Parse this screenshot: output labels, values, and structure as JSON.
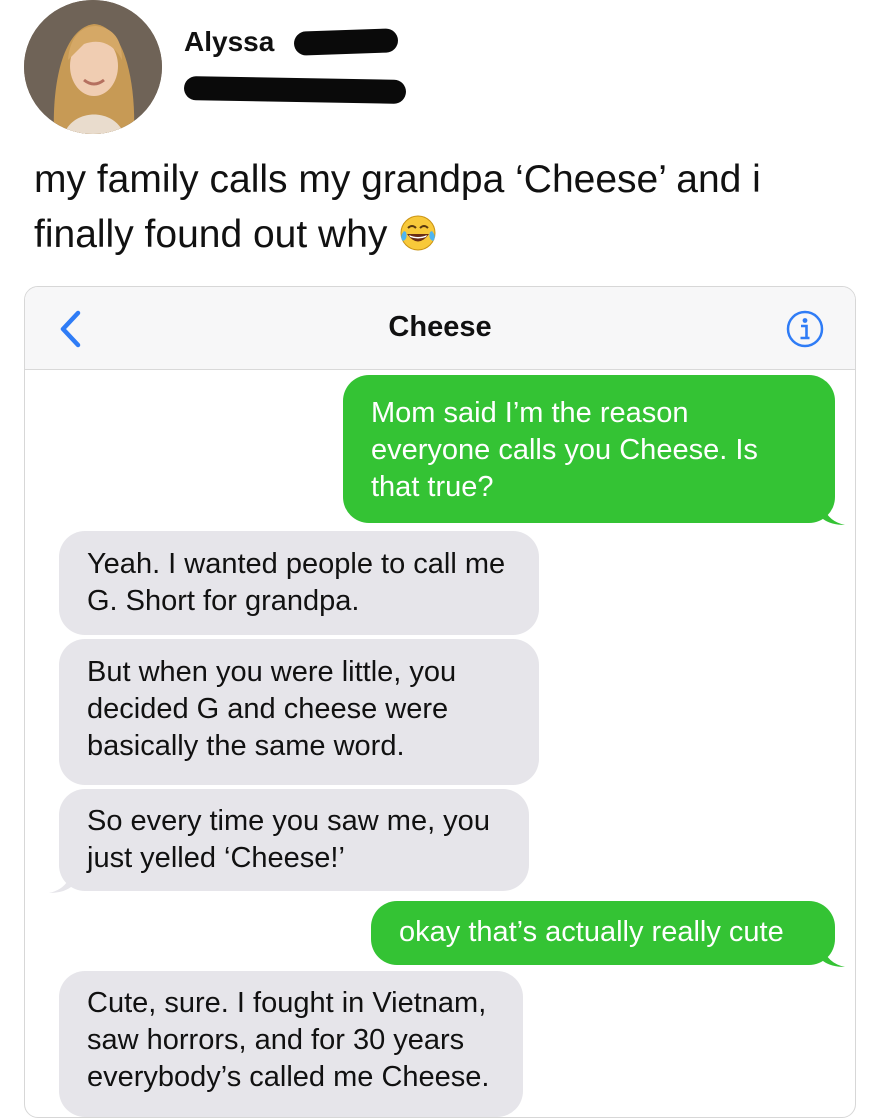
{
  "post": {
    "author": "Alyssa",
    "text": "my family calls my grandpa ‘Cheese’ and i finally found out why",
    "emoji_icon": "face-with-tears-of-joy-icon"
  },
  "conversation": {
    "contact": "Cheese",
    "back_icon": "chevron-left-icon",
    "info_icon": "info-icon",
    "accent_color": "#2f7cf6",
    "sent_color": "#34c334",
    "received_color": "#e6e5ea",
    "messages": [
      {
        "direction": "sent",
        "text": "Mom said I’m the reason everyone calls you Cheese. Is that true?"
      },
      {
        "direction": "received",
        "text": "Yeah. I wanted people to call me G. Short for grandpa."
      },
      {
        "direction": "received",
        "text": "But when you were little, you decided G and cheese were basically the same word."
      },
      {
        "direction": "received",
        "text": "So every time you saw me, you just yelled ‘Cheese!’"
      },
      {
        "direction": "sent",
        "text": "okay that’s actually really cute"
      },
      {
        "direction": "received",
        "text": "Cute, sure. I fought in Vietnam, saw horrors, and for 30 years everybody’s called me Cheese."
      }
    ]
  }
}
